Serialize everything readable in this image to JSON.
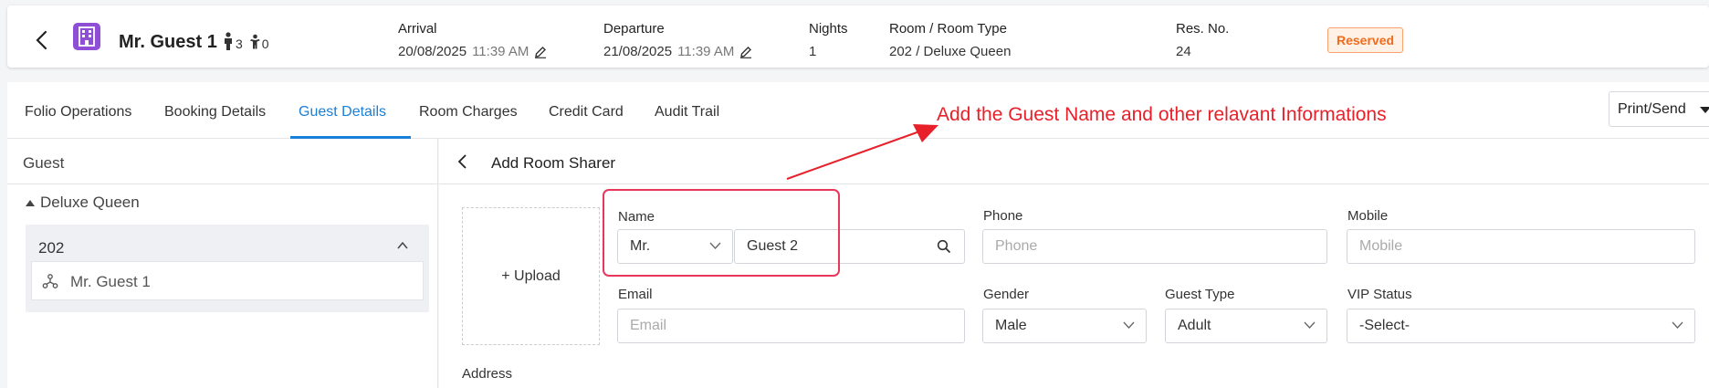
{
  "header": {
    "guest_name": "Mr. Guest 1",
    "adults": "3",
    "children": "0",
    "arrival_label": "Arrival",
    "arrival_date": "20/08/2025",
    "arrival_time": "11:39 AM",
    "departure_label": "Departure",
    "departure_date": "21/08/2025",
    "departure_time": "11:39 AM",
    "nights_label": "Nights",
    "nights_value": "1",
    "room_label": "Room / Room Type",
    "room_value": "202 / Deluxe Queen",
    "resno_label": "Res. No.",
    "resno_value": "24",
    "status": "Reserved",
    "hotel_icon_color": "#8e4fd6",
    "status_color": "#f26a1b"
  },
  "tabs": [
    {
      "label": "Folio Operations"
    },
    {
      "label": "Booking Details"
    },
    {
      "label": "Guest Details",
      "active": true
    },
    {
      "label": "Room Charges"
    },
    {
      "label": "Credit Card"
    },
    {
      "label": "Audit Trail"
    }
  ],
  "print_send": "Print/Send",
  "left": {
    "title": "Guest",
    "group": "Deluxe Queen",
    "room_no": "202",
    "sharer": "Mr. Guest 1"
  },
  "form": {
    "title": "Add Room Sharer",
    "upload": "+ Upload",
    "name_label": "Name",
    "salutation": "Mr.",
    "name_value": "Guest 2",
    "phone_label": "Phone",
    "phone_placeholder": "Phone",
    "mobile_label": "Mobile",
    "mobile_placeholder": "Mobile",
    "email_label": "Email",
    "email_placeholder": "Email",
    "gender_label": "Gender",
    "gender_value": "Male",
    "guest_type_label": "Guest Type",
    "guest_type_value": "Adult",
    "vip_label": "VIP Status",
    "vip_value": "-Select-",
    "address_label": "Address"
  },
  "annotation": {
    "text": "Add the Guest Name and other relavant Informations",
    "color": "#e8202a"
  },
  "accent_color": "#1a7fd6"
}
